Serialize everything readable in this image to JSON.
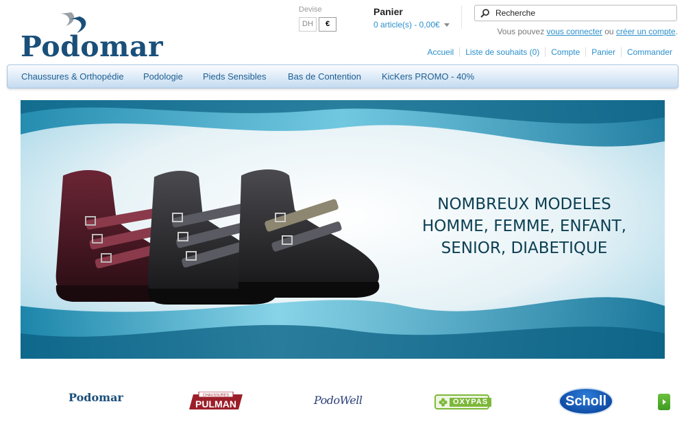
{
  "logo": {
    "text": "Podomar"
  },
  "currency": {
    "label": "Devise",
    "options": [
      "DH",
      "€"
    ],
    "selected": "€"
  },
  "cart": {
    "title": "Panier",
    "summary": "0 article(s) - 0,00€"
  },
  "search": {
    "value": "Recherche",
    "icon": "magnifier-icon"
  },
  "login_line": {
    "prefix": "Vous pouvez ",
    "login_link": "vous connecter",
    "middle": " ou ",
    "create_link": "créer un compte",
    "suffix": "."
  },
  "top_links": [
    "Accueil",
    "Liste de souhaits (0)",
    "Compte",
    "Panier",
    "Commander"
  ],
  "nav": [
    "Chaussures & Orthopédie",
    "Podologie",
    "Pieds Sensibles",
    "Bas de Contention",
    "KicKers PROMO - 40%"
  ],
  "banner": {
    "lines": [
      "NOMBREUX MODELES",
      "HOMME, FEMME, ENFANT,",
      "SENIOR, DIABETIQUE"
    ]
  },
  "brands": {
    "podomar": "Podomar",
    "pulman": "PULMAN",
    "pulman_small": "CHAUSSURES",
    "podowell": "PodoWell",
    "oxypas": "OXYPAS",
    "scholl": "Scholl"
  },
  "colors": {
    "link": "#2a8fcc",
    "brand_blue": "#1a4f7a",
    "nav_text": "#1e5f92",
    "banner_text": "#0b3e52"
  }
}
